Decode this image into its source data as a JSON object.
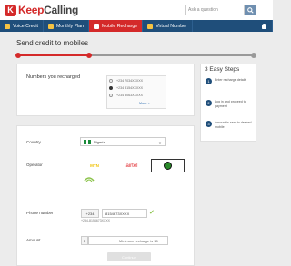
{
  "header": {
    "logo_initial": "K",
    "logo_part1": "Keep",
    "logo_part2": "Calling",
    "search_placeholder": "Ask a question",
    "brand_red": "#d42a2a",
    "nav_blue": "#1f4e7a"
  },
  "nav": {
    "items": [
      {
        "label": "Voice Credit",
        "active": false
      },
      {
        "label": "Monthly Plan",
        "active": false
      },
      {
        "label": "Mobile Recharge",
        "active": true
      },
      {
        "label": "Virtual Number",
        "active": false
      }
    ]
  },
  "page": {
    "title": "Send credit to mobiles"
  },
  "recharged": {
    "title": "Numbers you recharged",
    "numbers": [
      "+234 7034XXXXX",
      "+234 8154XXXXX",
      "+234 8063XXXXX"
    ],
    "selected_index": 1,
    "more": "More >"
  },
  "steps": {
    "title": "3 Easy Steps",
    "items": [
      {
        "num": "1",
        "text": "Enter recharge details"
      },
      {
        "num": "2",
        "text": "Log in and proceed to payment"
      },
      {
        "num": "3",
        "text": "Amount is sent to desired mobile"
      }
    ]
  },
  "form": {
    "country_label": "Country",
    "country_value": "Nigeria",
    "operator_label": "Operator",
    "operators": [
      "MTN",
      "airtel",
      "glo",
      "etisalat"
    ],
    "phone_label": "Phone number",
    "phone_prefix": "+234",
    "phone_value": "8154673XXXX",
    "phone_hint": "+234-8154673XXXX",
    "amount_label": "Amount",
    "amount_prefix": "$",
    "amount_placeholder": "Minimum recharge is 15",
    "continue_label": "Continue"
  }
}
